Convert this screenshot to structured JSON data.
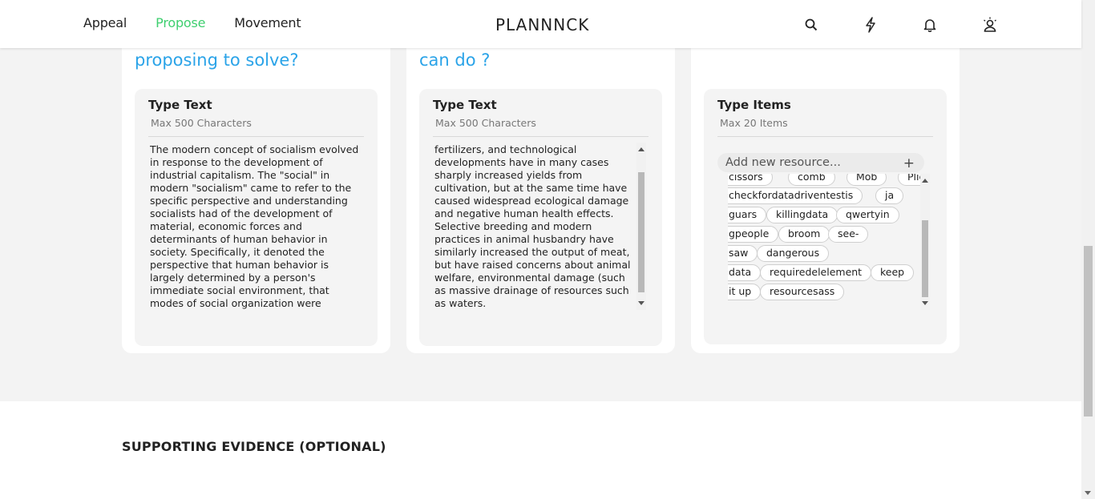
{
  "nav": {
    "items": [
      "Appeal",
      "Propose",
      "Movement"
    ],
    "active": "Propose"
  },
  "brand": {
    "logo": "PLANNNCK"
  },
  "header_icons": [
    "search-icon",
    "lightning-icon",
    "bell-icon",
    "profile-icon"
  ],
  "colors": {
    "accent": "#3ecf6f",
    "heading": "#2aa3e8"
  },
  "cards": [
    {
      "heading": "proposing to solve?",
      "title": "Type Text",
      "subtitle": "Max 500 Characters",
      "text": "The modern concept of socialism evolved\nin response to the development of\nindustrial capitalism. The \"social\" in\nmodern \"socialism\" came to refer to the\nspecific perspective and understanding\nsocialists had of the development of\nmaterial, economic forces and\ndeterminants of human behavior in\nsociety. Specifically, it denoted the\nperspective that human behavior is\nlargely determined by a person's\nimmediate social environment, that\nmodes of social organization were"
    },
    {
      "heading": "can do ?",
      "title": "Type Text",
      "subtitle": "Max 500 Characters",
      "text": "fertilizers, and technological\ndevelopments have in many cases\nsharply increased yields from\ncultivation, but at the same time have\ncaused widespread ecological damage\nand negative human health effects.\nSelective breeding and modern\npractices in animal husbandry have\nsimilarly increased the output of meat,\nbut have raised concerns about animal\nwelfare, environmental damage (such\nas massive drainage of resources such\nas waters."
    },
    {
      "heading": "",
      "title": "Type Items",
      "subtitle": "Max 20 Items",
      "placeholder": "Add new resource...",
      "tags": [
        "cissors",
        "comb",
        "Mob",
        "Plier",
        "checkfordatadriventestis",
        "ja",
        "guars",
        "killingdata",
        "qwertyin",
        "gpeople",
        "broom",
        "see-",
        "saw",
        "dangerous",
        "data",
        "requiredelelement",
        "keep",
        "it up",
        "resourcesass"
      ]
    }
  ],
  "section": {
    "title": "SUPPORTING EVIDENCE (OPTIONAL)"
  }
}
